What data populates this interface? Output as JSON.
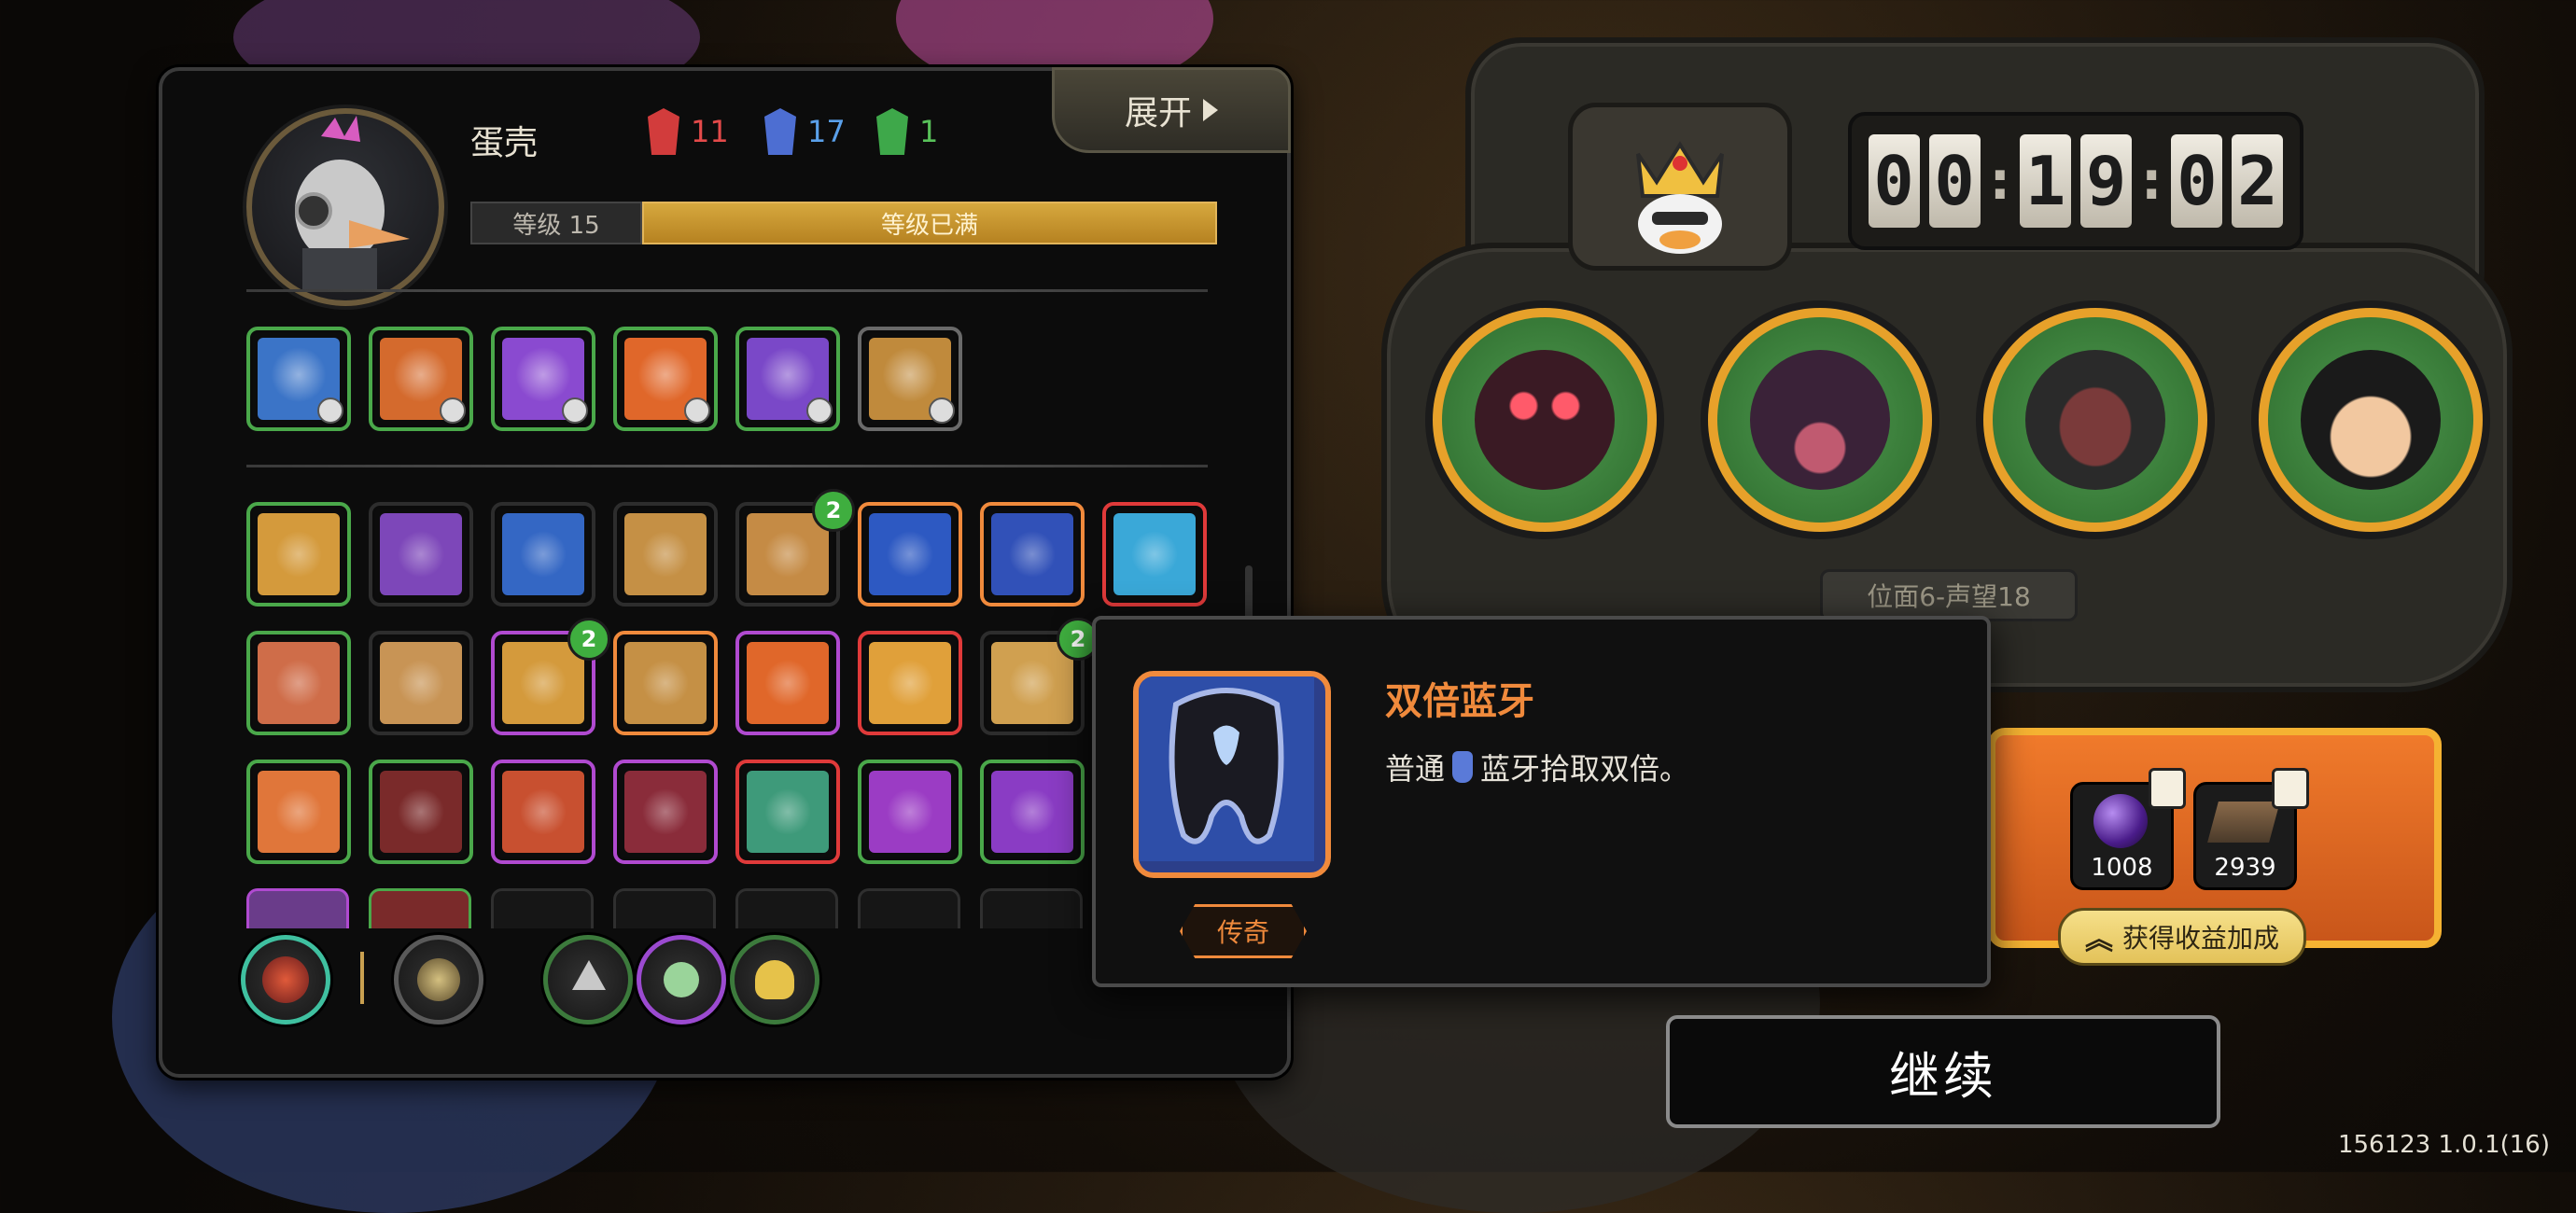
{
  "player": {
    "name": "蛋壳",
    "stats": [
      {
        "icon": "red-tier-icon",
        "value": "11",
        "color": "#e44a4a"
      },
      {
        "icon": "blue-tier-icon",
        "value": "17",
        "color": "#5aa0ea"
      },
      {
        "icon": "green-tier-icon",
        "value": "1",
        "color": "#58c25a"
      }
    ],
    "level_label": "等级 15",
    "level_status": "等级已满",
    "expand_label": "展开"
  },
  "weapons": [
    {
      "name": "weapon-slot",
      "border": "#4aa84a",
      "art": "#3b74c7"
    },
    {
      "name": "weapon-slot",
      "border": "#4aa84a",
      "art": "#d46a2d"
    },
    {
      "name": "weapon-slot",
      "border": "#4aa84a",
      "art": "#8a4ad0"
    },
    {
      "name": "weapon-slot",
      "border": "#4aa84a",
      "art": "#e0672a"
    },
    {
      "name": "weapon-slot",
      "border": "#4aa84a",
      "art": "#7a48c8"
    },
    {
      "name": "weapon-slot",
      "border": "#6a6a6a",
      "art": "#c08a3c"
    }
  ],
  "items": [
    [
      {
        "border": "#4aa84a",
        "art": "#d49a3c",
        "count": ""
      },
      {
        "border": "#2d2d2d",
        "art": "#7d47b9",
        "count": ""
      },
      {
        "border": "#2d2d2d",
        "art": "#3467c4",
        "count": ""
      },
      {
        "border": "#2d2d2d",
        "art": "#c59045",
        "count": ""
      },
      {
        "border": "#2d2d2d",
        "art": "#c58b45",
        "count": "2"
      },
      {
        "border": "#f08a3c",
        "art": "#2d59c2",
        "count": ""
      },
      {
        "border": "#f08a3c",
        "art": "#3151b8",
        "count": ""
      },
      {
        "border": "#e03a3a",
        "art": "#3aa8d8",
        "count": ""
      }
    ],
    [
      {
        "border": "#4aa84a",
        "art": "#cf6d49",
        "count": ""
      },
      {
        "border": "#2d2d2d",
        "art": "#c89455",
        "count": ""
      },
      {
        "border": "#b04ad0",
        "art": "#d49a3c",
        "count": "2"
      },
      {
        "border": "#f08a3c",
        "art": "#c59045",
        "count": ""
      },
      {
        "border": "#b04ad0",
        "art": "#e0672a",
        "count": ""
      },
      {
        "border": "#e03a3a",
        "art": "#e0a03a",
        "count": ""
      },
      {
        "border": "#2d2d2d",
        "art": "#d0a050",
        "count": "2"
      }
    ],
    [
      {
        "border": "#4aa84a",
        "art": "#e0763a",
        "count": ""
      },
      {
        "border": "#4aa84a",
        "art": "#7a2a2a",
        "count": ""
      },
      {
        "border": "#b04ad0",
        "art": "#c85030",
        "count": ""
      },
      {
        "border": "#b04ad0",
        "art": "#8a2c3a",
        "count": ""
      },
      {
        "border": "#e03a3a",
        "art": "#3e9a7a",
        "count": ""
      },
      {
        "border": "#4aa84a",
        "art": "#9b3cc4",
        "count": ""
      },
      {
        "border": "#4aa84a",
        "art": "#8a3cc4",
        "count": ""
      }
    ]
  ],
  "timer": {
    "digits": [
      "0",
      "0",
      "1",
      "9",
      "0",
      "2"
    ]
  },
  "planet_label": "位面6-声望18",
  "enemies": [
    {
      "name": "enemy-portrait-bug",
      "face": "#c0394a"
    },
    {
      "name": "enemy-portrait-demon",
      "face": "#6b3a6b"
    },
    {
      "name": "enemy-portrait-alien",
      "face": "#5a3a3a"
    },
    {
      "name": "enemy-portrait-human",
      "face": "#f2c8a0"
    }
  ],
  "reward": {
    "items": [
      {
        "icon": "purple-orb-icon",
        "value": "1008"
      },
      {
        "icon": "brown-crate-icon",
        "value": "2939"
      }
    ],
    "bonus_label": "获得收益加成"
  },
  "tooltip": {
    "title": "双倍蓝牙",
    "desc_prefix": "普通",
    "desc_suffix": "蓝牙拾取双倍。",
    "rarity": "传奇"
  },
  "continue_label": "继续",
  "version": "156123 1.0.1(16)"
}
